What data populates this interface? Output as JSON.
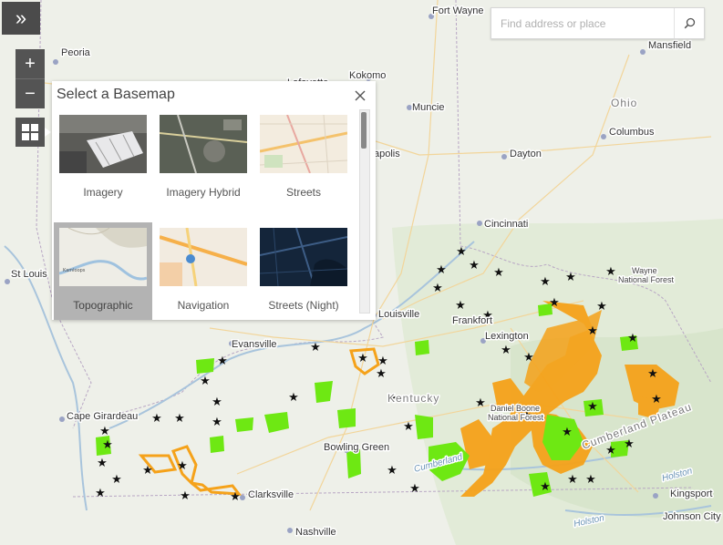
{
  "map": {
    "cities": [
      {
        "name": "Fort Wayne"
      },
      {
        "name": "Mansfield"
      },
      {
        "name": "Peoria"
      },
      {
        "name": "Kokomo"
      },
      {
        "name": "Lafayette"
      },
      {
        "name": "Muncie"
      },
      {
        "name": "Ohio"
      },
      {
        "name": "Columbus"
      },
      {
        "name": "Indianapolis"
      },
      {
        "name": "Dayton"
      },
      {
        "name": "Cincinnati"
      },
      {
        "name": "St Louis"
      },
      {
        "name": "Wayne"
      },
      {
        "name": "National Forest"
      },
      {
        "name": "Louisville"
      },
      {
        "name": "Frankfort"
      },
      {
        "name": "Lexington"
      },
      {
        "name": "Evansville"
      },
      {
        "name": "Kentucky"
      },
      {
        "name": "Cape Girardeau"
      },
      {
        "name": "Daniel Boone"
      },
      {
        "name": "National Forest"
      },
      {
        "name": "Bowling Green"
      },
      {
        "name": "Cumberland Plateau"
      },
      {
        "name": "Clarksville"
      },
      {
        "name": "Kingsport"
      },
      {
        "name": "Johnson City"
      },
      {
        "name": "Nashville"
      },
      {
        "name": "Holston"
      },
      {
        "name": "Holston"
      },
      {
        "name": "Cumberland"
      }
    ]
  },
  "controls": {
    "expand_glyph": "»",
    "zoom_in": "+",
    "zoom_out": "−"
  },
  "search": {
    "placeholder": "Find address or place"
  },
  "basemap_panel": {
    "title": "Select a Basemap",
    "basemaps": [
      {
        "label": "Imagery"
      },
      {
        "label": "Imagery Hybrid"
      },
      {
        "label": "Streets"
      },
      {
        "label": "Topographic",
        "selected": true
      },
      {
        "label": "Navigation"
      },
      {
        "label": "Streets (Night)"
      }
    ]
  }
}
